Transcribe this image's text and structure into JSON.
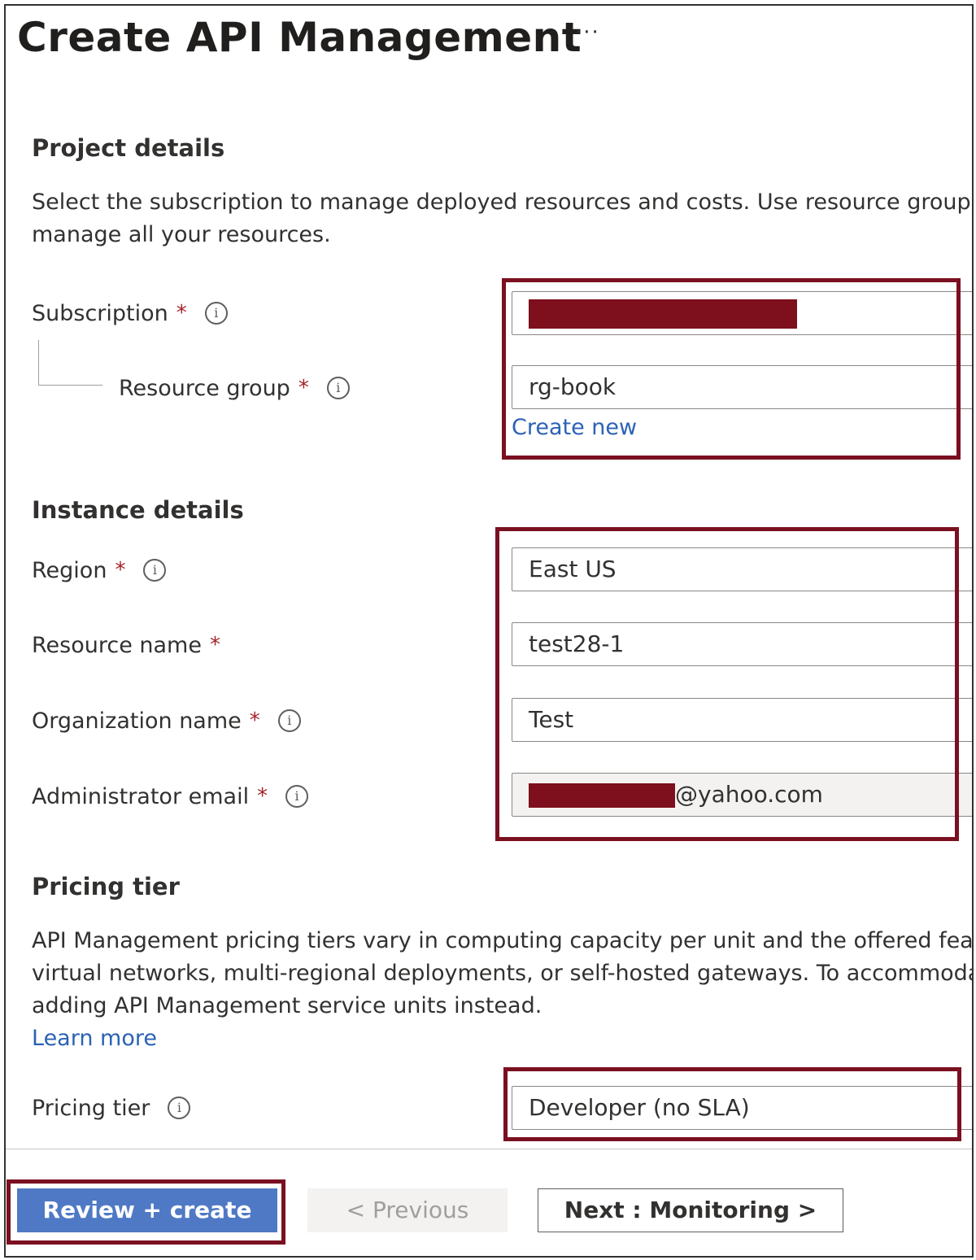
{
  "header": {
    "title": "Create API Management",
    "more_label": "···"
  },
  "project_details": {
    "heading": "Project details",
    "description_lines": [
      "Select the subscription to manage deployed resources and costs. Use resource groups",
      "manage all your resources."
    ],
    "subscription": {
      "label": "Subscription",
      "required": "*",
      "value": ""
    },
    "resource_group": {
      "label": "Resource group",
      "required": "*",
      "value": "rg-book",
      "create_new_label": "Create new"
    }
  },
  "instance_details": {
    "heading": "Instance details",
    "region": {
      "label": "Region",
      "required": "*",
      "value": "East US"
    },
    "resource_name": {
      "label": "Resource name",
      "required": "*",
      "value": "test28-1"
    },
    "organization_name": {
      "label": "Organization name",
      "required": "*",
      "value": "Test"
    },
    "admin_email": {
      "label": "Administrator email",
      "required": "*",
      "value_suffix": "@yahoo.com"
    }
  },
  "pricing": {
    "heading": "Pricing tier",
    "description_lines": [
      "API Management pricing tiers vary in computing capacity per unit and the offered fea",
      "virtual networks, multi-regional deployments, or self-hosted gateways. To accommoda",
      "adding API Management service units instead."
    ],
    "learn_more_label": "Learn more",
    "tier": {
      "label": "Pricing tier",
      "value": "Developer (no SLA)"
    }
  },
  "footer": {
    "review_create_label": "Review + create",
    "previous_label": "< Previous",
    "next_label": "Next : Monitoring >"
  },
  "info_glyph": "i",
  "colors": {
    "highlight": "#7a1020",
    "redaction": "#7e0f1c",
    "primary_button": "#4f79c4",
    "link": "#2b62b6",
    "required": "#a4262c"
  }
}
